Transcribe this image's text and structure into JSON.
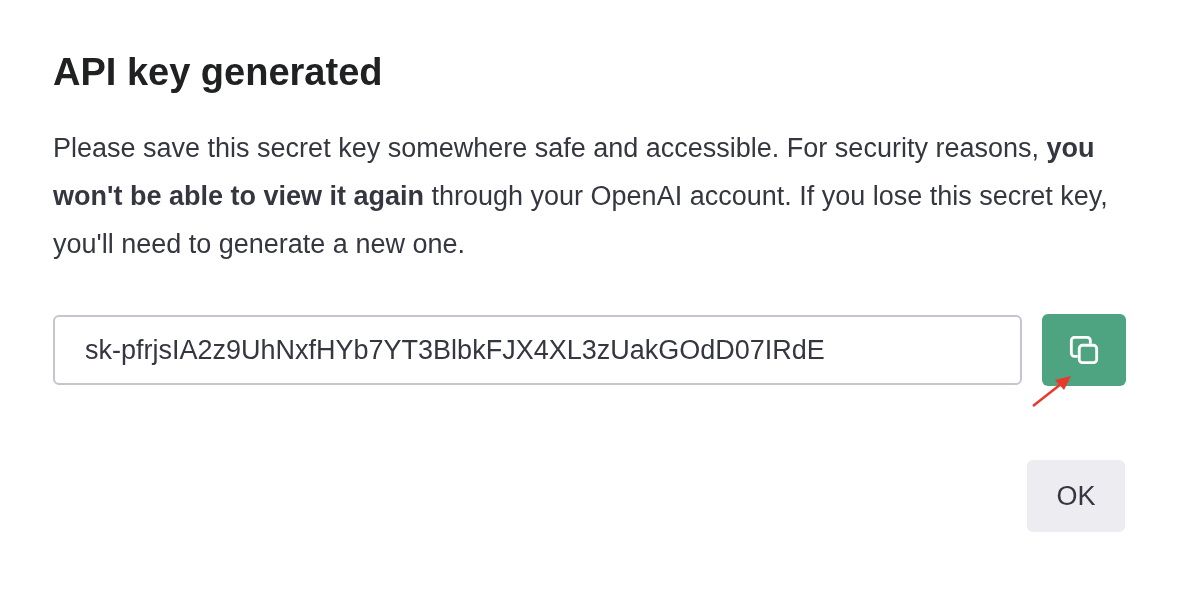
{
  "dialog": {
    "title": "API key generated",
    "message": "Please save this secret key somewhere safe and accessible. For security reasons, **you won't be able to view it again** through your OpenAI account. If you lose this secret key, you'll need to generate a new one.",
    "key_field": {
      "value": "sk-pfrjsIA2z9UhNxfHYb7YT3BlbkFJX4XL3zUakGOdD07IRdE"
    },
    "buttons": [
      {
        "label": "OK"
      }
    ]
  }
}
